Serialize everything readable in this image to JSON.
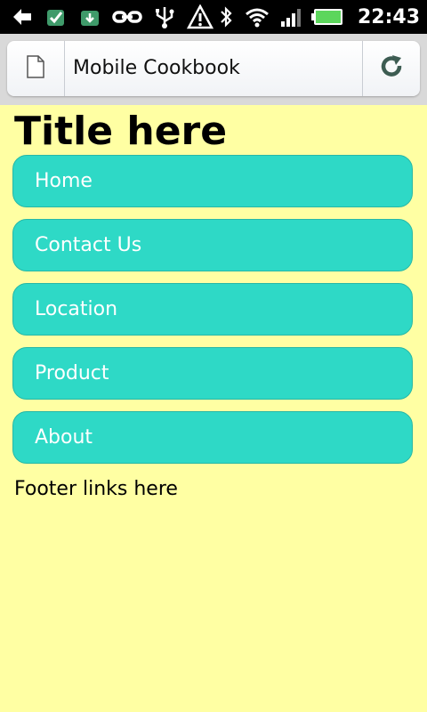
{
  "status_bar": {
    "time": "22:43",
    "left_icons": [
      "back-arrow-icon",
      "checkbox-notification-icon",
      "download-bag-icon",
      "link-icon",
      "usb-icon",
      "warning-icon"
    ],
    "right_icons": [
      "bluetooth-icon",
      "wifi-icon",
      "signal-icon",
      "battery-icon"
    ],
    "battery_color": "#5cd65c"
  },
  "browser": {
    "page_title": "Mobile Cookbook"
  },
  "page": {
    "title": "Title here",
    "nav_items": [
      {
        "label": "Home"
      },
      {
        "label": "Contact Us"
      },
      {
        "label": "Location"
      },
      {
        "label": "Product"
      },
      {
        "label": "About"
      }
    ],
    "footer": "Footer links here"
  },
  "colors": {
    "page_background": "#ffffa3",
    "nav_button": "#2ed9c6",
    "nav_text": "#ffffff"
  }
}
